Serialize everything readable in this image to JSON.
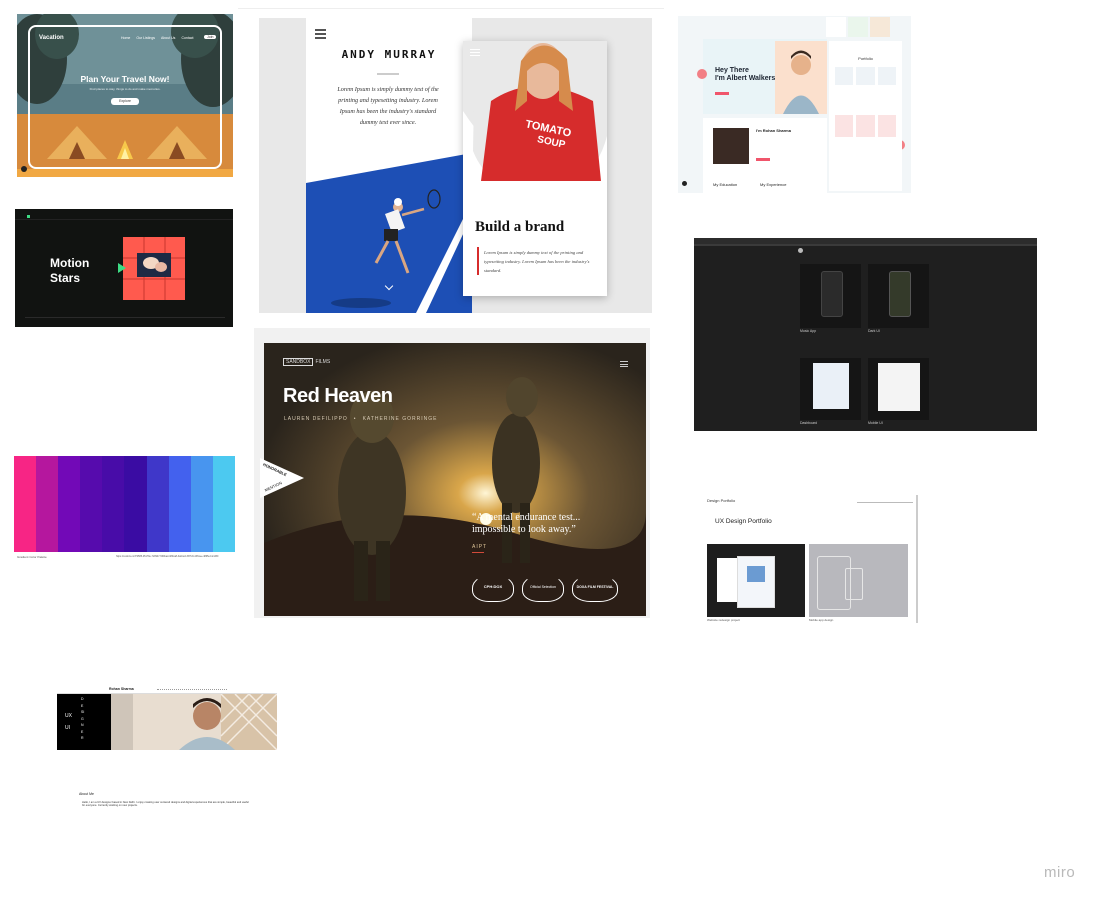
{
  "board": {
    "watermark": "miro"
  },
  "cards": {
    "vacation": {
      "logo": "Vacation",
      "nav": [
        "Home",
        "Our Listings",
        "About Us",
        "Contact"
      ],
      "nav_button": "Join",
      "title": "Plan Your Travel Now!",
      "subtitle": "Find places to stay, things to do and make memories.",
      "cta": "Explore"
    },
    "motion": {
      "title_line1": "Motion",
      "title_line2": "Stars"
    },
    "andy": {
      "name": "ANDY MURRAY",
      "body": "Lorem Ipsum is simply dummy text of the printing and typesetting industry. Lorem Ipsum has been the industry's standard dummy text ever since.",
      "sweater_line1": "TOMATO",
      "sweater_line2": "SOUP",
      "brand_title": "Build a brand",
      "brand_body": "Lorem Ipsum is simply dummy text of the printing and typesetting industry. Lorem Ipsum has been the industry's standard."
    },
    "red_heaven": {
      "logo_left": "SANDBOX",
      "logo_right": "FILMS",
      "title": "Red Heaven",
      "credit_1": "LAUREN DEFILIPPO",
      "credit_2": "KATHERINE GORRINGE",
      "quote_line1": "“A mental endurance test...",
      "quote_line2": "impossible to look away.”",
      "quote_source": "AIPT",
      "badge_line1": "HONORABLE",
      "badge_line2": "MENTION",
      "laurels": [
        "CPH:DOX",
        "Official Selection",
        "DOXA FILM FESTIVAL"
      ]
    },
    "albert": {
      "greeting_line1": "Hey There",
      "greeting_line2": "I'm Albert Walkers",
      "portfolio_heading": "Portfolio",
      "testimonial_title": "I'm Rohan Sharma",
      "label_1": "My Education",
      "label_2": "My Experience"
    },
    "palette": {
      "colors": [
        "#f72585",
        "#b5179e",
        "#7209b7",
        "#560bad",
        "#480ca8",
        "#3a0ca3",
        "#3f37c9",
        "#4361ee",
        "#4895ef",
        "#4cc9f0"
      ],
      "caption_left": "Gradient Color Palette",
      "caption_right": "https://coolors.co/f72585-b5179e-7209b7-560bad-480ca8-3a0ca3-3f37c9-4361ee-4895ef-4cc9f0"
    },
    "dark_dash": {
      "tile_labels": [
        "Music App",
        "Dark UI",
        "Dashboard",
        "Mobile UI"
      ]
    },
    "ux_portfolio": {
      "brand": "Design Portfolio",
      "title": "UX Design Portfolio",
      "caption_1": "Website redesign project",
      "caption_2": "Mobile app design"
    },
    "ux_designer": {
      "header_name": "Rohan Sharma",
      "side_label_1": "UX",
      "side_label_2": "UI",
      "vertical_word": "DESIGNER",
      "section_heading": "About Me",
      "body": "Hello, I am a UX designer based in New Delhi. I enjoy creating user centered designs and digital experiences that are simple, beautiful and useful for everyone. Currently working on new projects."
    }
  }
}
